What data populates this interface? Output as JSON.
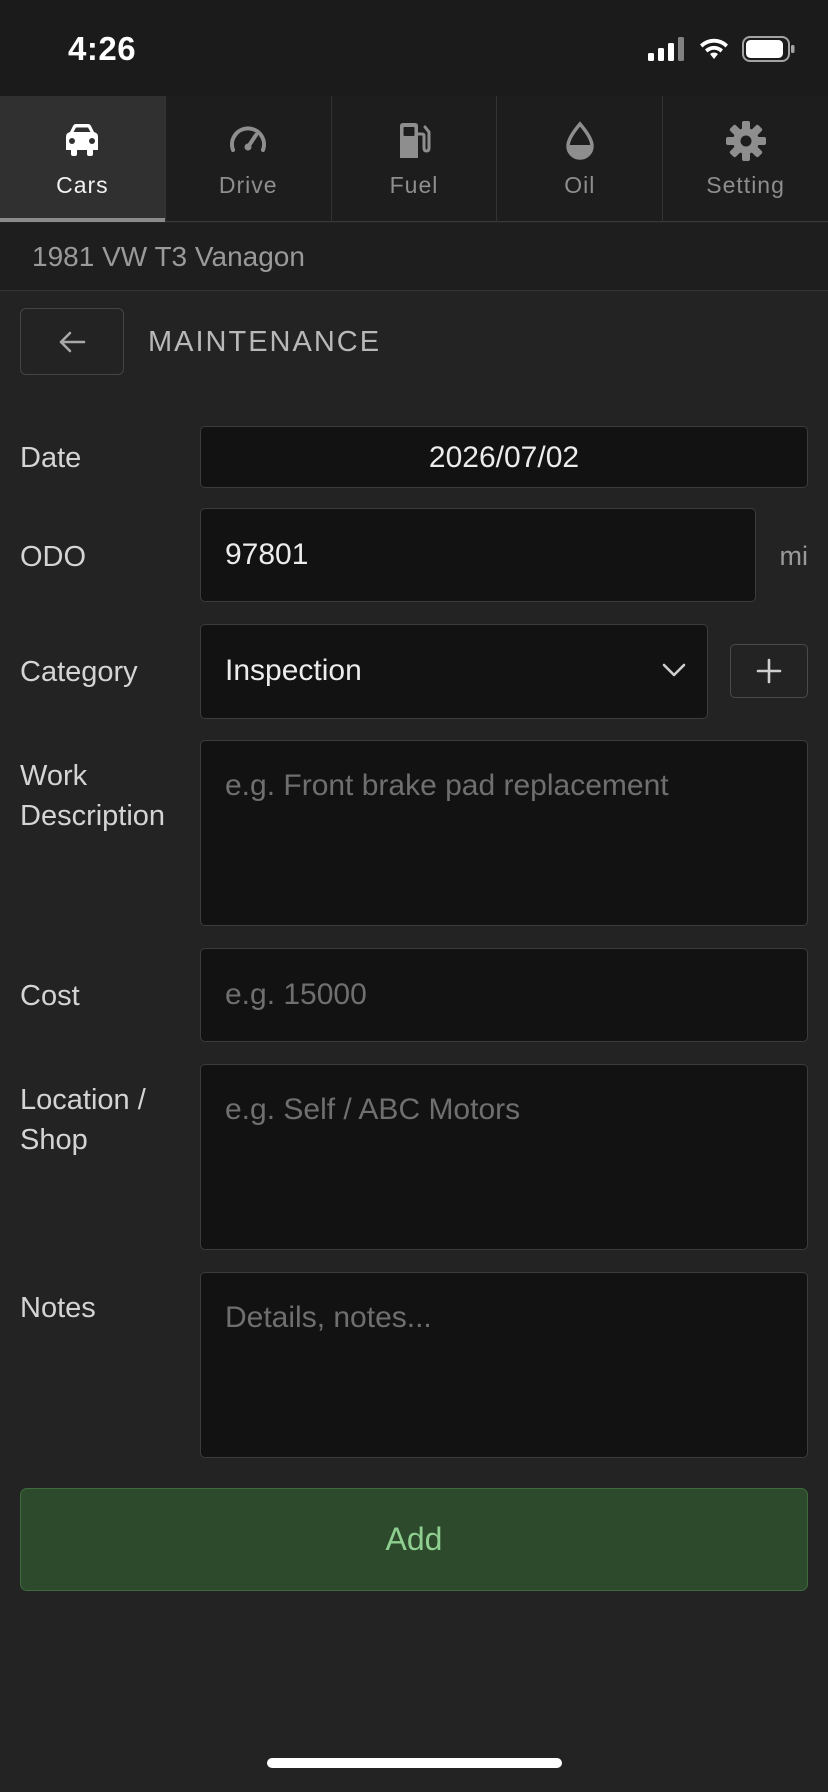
{
  "status": {
    "time": "4:26"
  },
  "tabs": [
    {
      "label": "Cars",
      "icon": "car-icon",
      "active": true
    },
    {
      "label": "Drive",
      "icon": "speedometer-icon"
    },
    {
      "label": "Fuel",
      "icon": "fuel-pump-icon"
    },
    {
      "label": "Oil",
      "icon": "oil-drop-icon"
    },
    {
      "label": "Setting",
      "icon": "gear-icon"
    }
  ],
  "car": {
    "name": "1981 VW T3 Vanagon"
  },
  "section": {
    "title": "MAINTENANCE"
  },
  "form": {
    "date": {
      "label": "Date",
      "value": "2026/07/02"
    },
    "odo": {
      "label": "ODO",
      "value": "97801",
      "unit": "mi"
    },
    "category": {
      "label": "Category",
      "value": "Inspection"
    },
    "work": {
      "label_line1": "Work",
      "label_line2": "Description",
      "placeholder": "e.g. Front brake pad replacement"
    },
    "cost": {
      "label": "Cost",
      "placeholder": "e.g. 15000"
    },
    "location": {
      "label_line1": "Location /",
      "label_line2": "Shop",
      "placeholder": "e.g. Self / ABC Motors"
    },
    "notes": {
      "label": "Notes",
      "placeholder": "Details, notes..."
    }
  },
  "actions": {
    "add_label": "Add"
  },
  "colors": {
    "accent_green_bg": "#2d4a2d",
    "accent_green_text": "#8fcf8f"
  }
}
